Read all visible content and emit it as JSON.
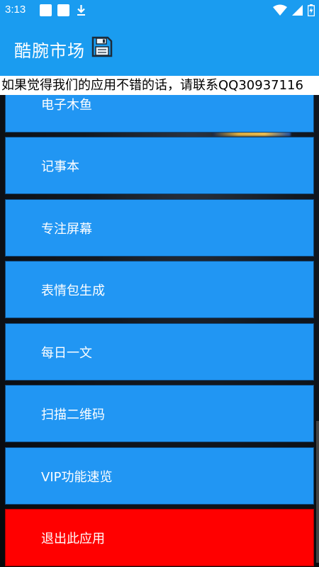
{
  "status_bar": {
    "time": "3:13",
    "icons": [
      "notification-square-icon",
      "notification-square-icon",
      "download-icon",
      "wifi-icon",
      "signal-icon",
      "battery-icon"
    ]
  },
  "app_bar": {
    "title": "酷腕市场",
    "icon": "save-icon",
    "background": "#1a9cf0"
  },
  "marquee_text": "如果觉得我们的应用不错的话，请联系QQ30937116",
  "menu": {
    "items": [
      {
        "label": "电子木鱼"
      },
      {
        "label": "记事本"
      },
      {
        "label": "专注屏幕"
      },
      {
        "label": "表情包生成"
      },
      {
        "label": "每日一文"
      },
      {
        "label": "扫描二维码"
      },
      {
        "label": "VIP功能速览"
      },
      {
        "label": "退出此应用"
      }
    ],
    "item_color": "#2196f3",
    "exit_color": "#ff0000"
  }
}
